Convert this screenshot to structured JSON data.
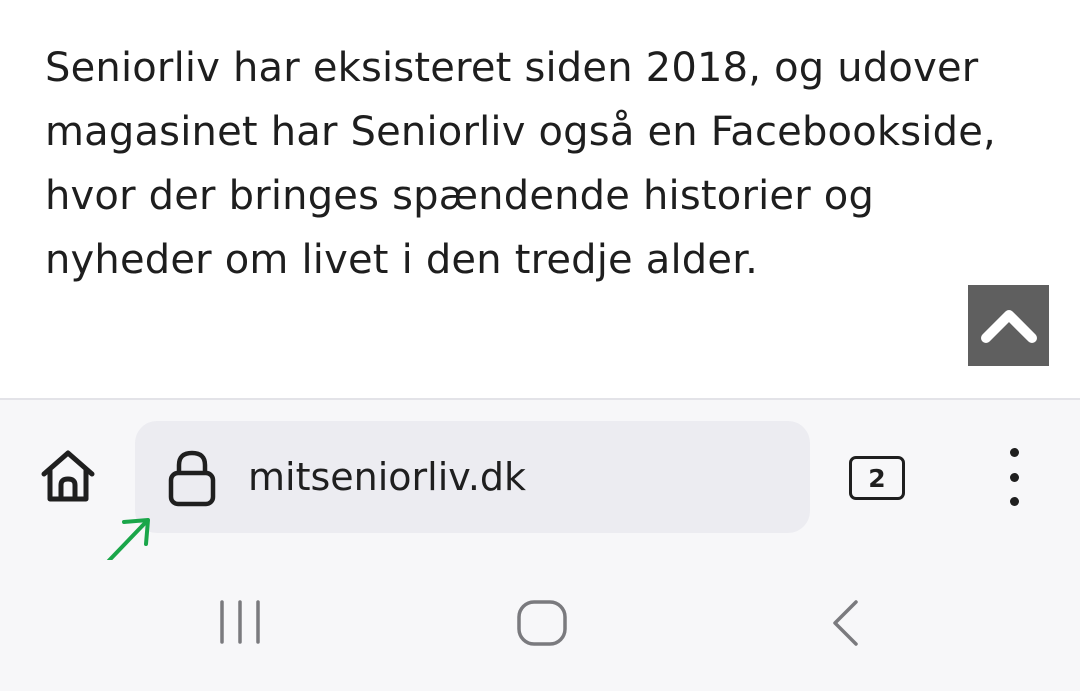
{
  "article": {
    "paragraph": "Seniorliv har eksisteret siden 2018, og udover magasinet har Seniorliv også en Facebookside, hvor der bringes spændende historier og nyheder om livet i den tredje alder."
  },
  "scroll_top": {
    "icon": "chevron-up-icon",
    "background": "#5f5f5f"
  },
  "toolbar": {
    "home_icon": "home-icon",
    "address_bar": {
      "lock_icon": "lock-icon",
      "url": "mitseniorliv.dk"
    },
    "tab_count": "2",
    "menu_icon": "more-vertical-icon"
  },
  "annotation": {
    "icon": "arrow-annotation",
    "color": "#1aa64a"
  },
  "navigation_bar": {
    "recents_icon": "recent-apps-icon",
    "home_icon": "home-circle-icon",
    "back_icon": "back-chevron-icon"
  }
}
